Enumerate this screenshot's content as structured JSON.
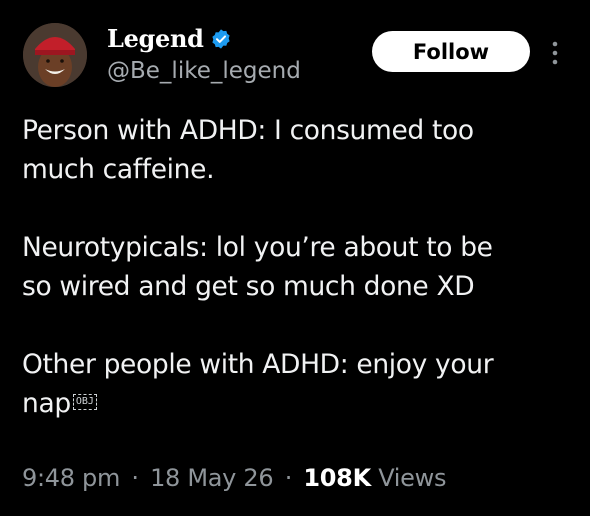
{
  "author": {
    "display_name": "Legend",
    "handle": "@Be_like_legend",
    "verified": true,
    "avatar": "avatar-photo"
  },
  "follow_button": {
    "label": "Follow"
  },
  "more_menu": {
    "icon": "more-vertical-icon"
  },
  "tweet": {
    "paragraphs": [
      {
        "lines": [
          "Person with ADHD: I consumed too",
          "much caffeine."
        ]
      },
      {
        "lines": [
          "Neurotypicals: lol you’re about to be",
          "so wired and get so much done XD"
        ]
      },
      {
        "lines": [
          "Other people with ADHD: enjoy your",
          "nap"
        ]
      }
    ],
    "trailing_glyph": "OBJ"
  },
  "meta": {
    "time": "9:48 pm",
    "date": "18 May 26",
    "views_count": "108K",
    "views_label": "Views",
    "separator": "·"
  },
  "colors": {
    "background": "#000000",
    "primary_text": "#e7e9ea",
    "secondary_text": "#8f959a",
    "verified_blue": "#1d9bf0",
    "follow_bg": "#ffffff"
  }
}
